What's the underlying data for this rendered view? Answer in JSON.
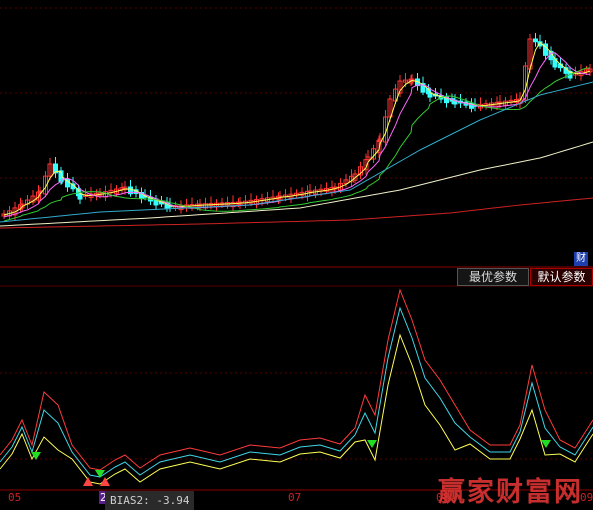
{
  "buttons": {
    "optimal": "最优参数",
    "default": "默认参数"
  },
  "badge": "财",
  "indicator": {
    "name": "BIAS2",
    "value": "-3.94",
    "text": "BIAS2: -3.94"
  },
  "x_labels": [
    "05",
    "2",
    "07",
    "08",
    "09"
  ],
  "watermark": "赢家财富网",
  "colors": {
    "up": "#ff3333",
    "down": "#33ffff",
    "ma_yellow": "#ffff55",
    "ma_magenta": "#ff66ff",
    "ma_green": "#33cc33",
    "ma_teal": "#33aacc",
    "ma_white": "#f0f0c8",
    "ma_red": "#cc2222",
    "bias_red": "#ff3b3b",
    "bias_cyan": "#3fd7e8",
    "bias_yellow": "#ffff55",
    "grid": "#8b0000"
  }
}
